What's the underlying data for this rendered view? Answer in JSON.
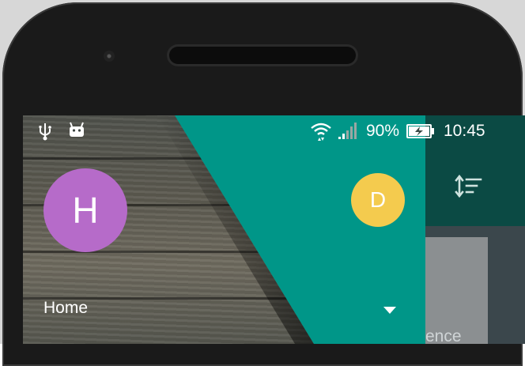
{
  "status_bar": {
    "battery_percent": "90%",
    "time": "10:45",
    "icons": [
      "usb-icon",
      "android-debug-icon",
      "wifi-icon",
      "cellular-signal-icon",
      "battery-charging-icon"
    ]
  },
  "drawer_header": {
    "current_account_initial": "H",
    "other_account_initial": "D",
    "account_name": "Home"
  },
  "background_app": {
    "toolbar_icon": "sort-icon",
    "card_text": "ence"
  },
  "colors": {
    "teal": "#009688",
    "avatar_purple": "#B66BC9",
    "avatar_yellow": "#F4CB4E",
    "app_bar_dark": "#0B4A44"
  }
}
